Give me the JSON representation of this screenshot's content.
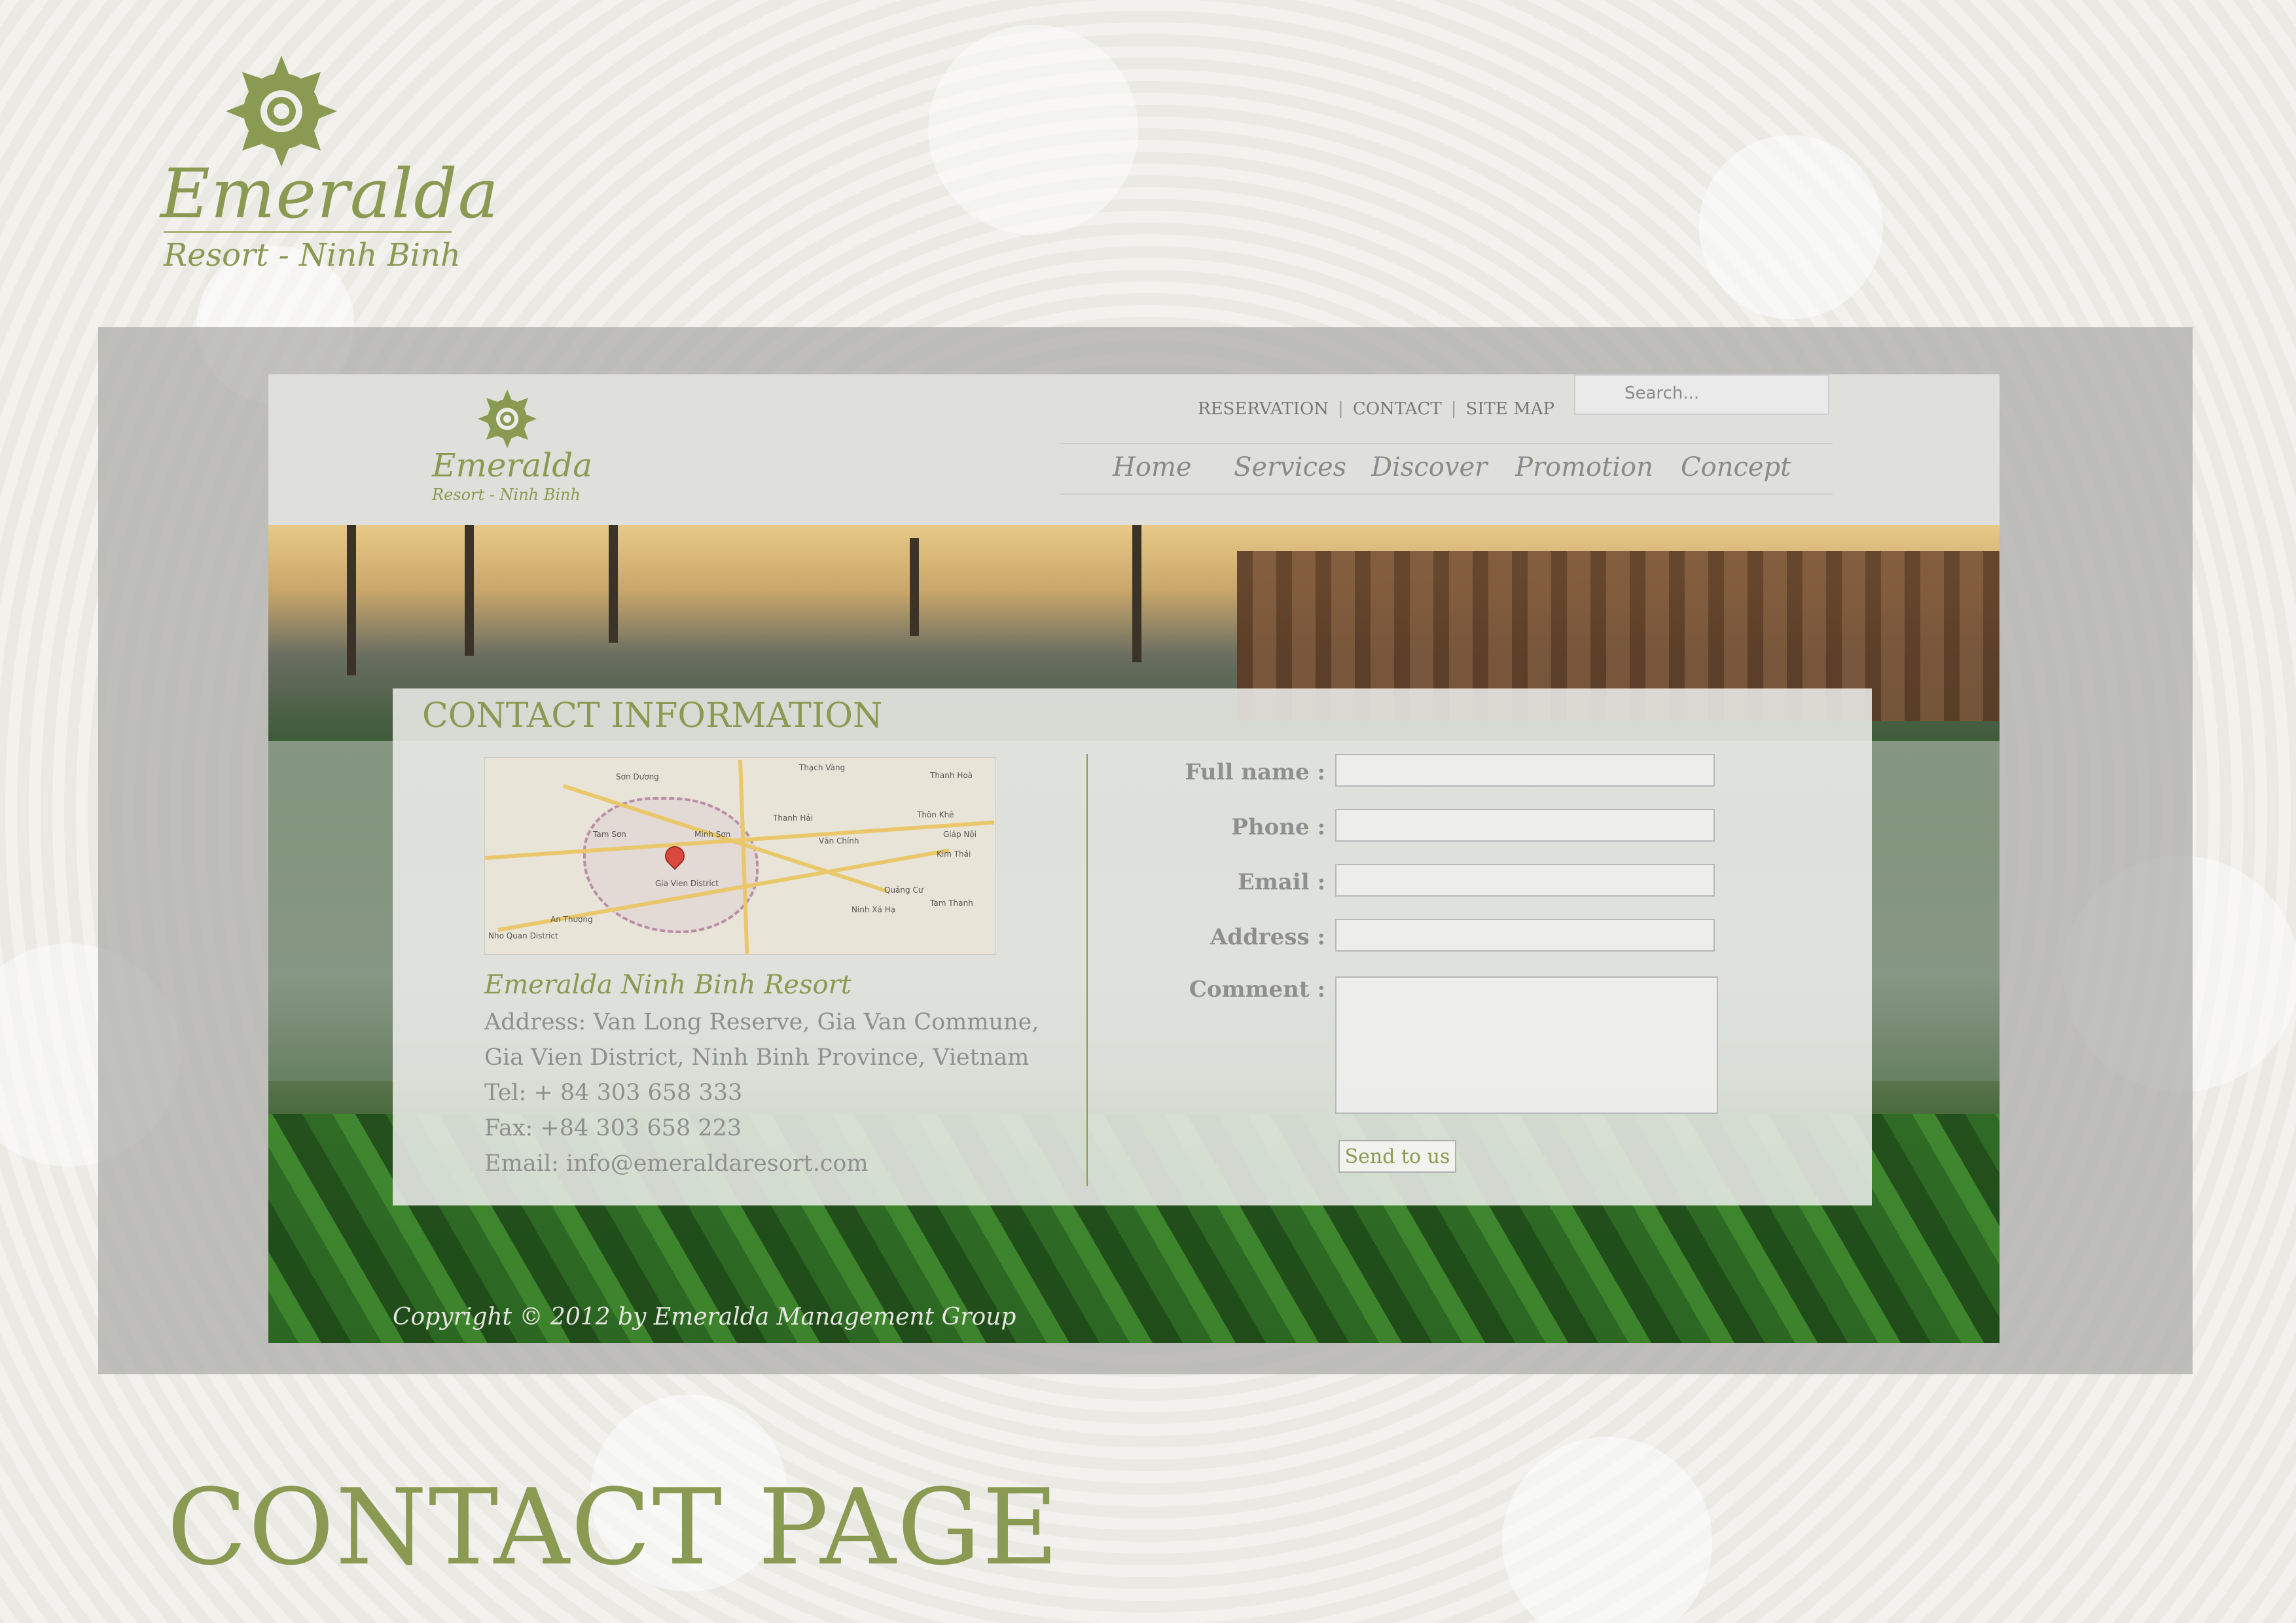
{
  "branding": {
    "name": "Emeralda",
    "tagline": "Resort - Ninh Binh",
    "logo_icon": "sun-flower-logo-icon",
    "accent_color": "#8a9a52"
  },
  "header": {
    "top_links": [
      "RESERVATION",
      "CONTACT",
      "SITE MAP"
    ],
    "search_placeholder": "Search..."
  },
  "nav": {
    "items": [
      "Home",
      "Services",
      "Discover",
      "Promotion",
      "Concept"
    ]
  },
  "contact": {
    "title": "CONTACT INFORMATION",
    "resort_name": "Emeralda Ninh Binh Resort",
    "address_line1": "Address: Van Long Reserve, Gia Van Commune,",
    "address_line2": "Gia Vien District, Ninh Binh Province, Vietnam",
    "tel": "Tel: + 84 303 658 333",
    "fax": "Fax: +84 303 658 223",
    "email": "Email: info@emeraldaresort.com",
    "map": {
      "labels": [
        "Thạch Vàng",
        "Sơn Dương",
        "Tam Sơn",
        "Minh Sơn",
        "Thanh Hải",
        "Văn Chính",
        "Gia Vien District",
        "Nho Quan District",
        "An Thượng",
        "Quảng Cư",
        "Ninh Xá Hạ",
        "Tam Thanh",
        "Thôn Khê",
        "Giáp Nội",
        "Kim Thái",
        "Thanh Hoà"
      ]
    }
  },
  "form": {
    "labels": [
      "Full name :",
      "Phone :",
      "Email :",
      "Address :",
      "Comment :"
    ],
    "submit_label": "Send to us"
  },
  "footer": {
    "copyright": "Copyright © 2012 by Emeralda Management Group"
  },
  "page_heading": "CONTACT PAGE"
}
